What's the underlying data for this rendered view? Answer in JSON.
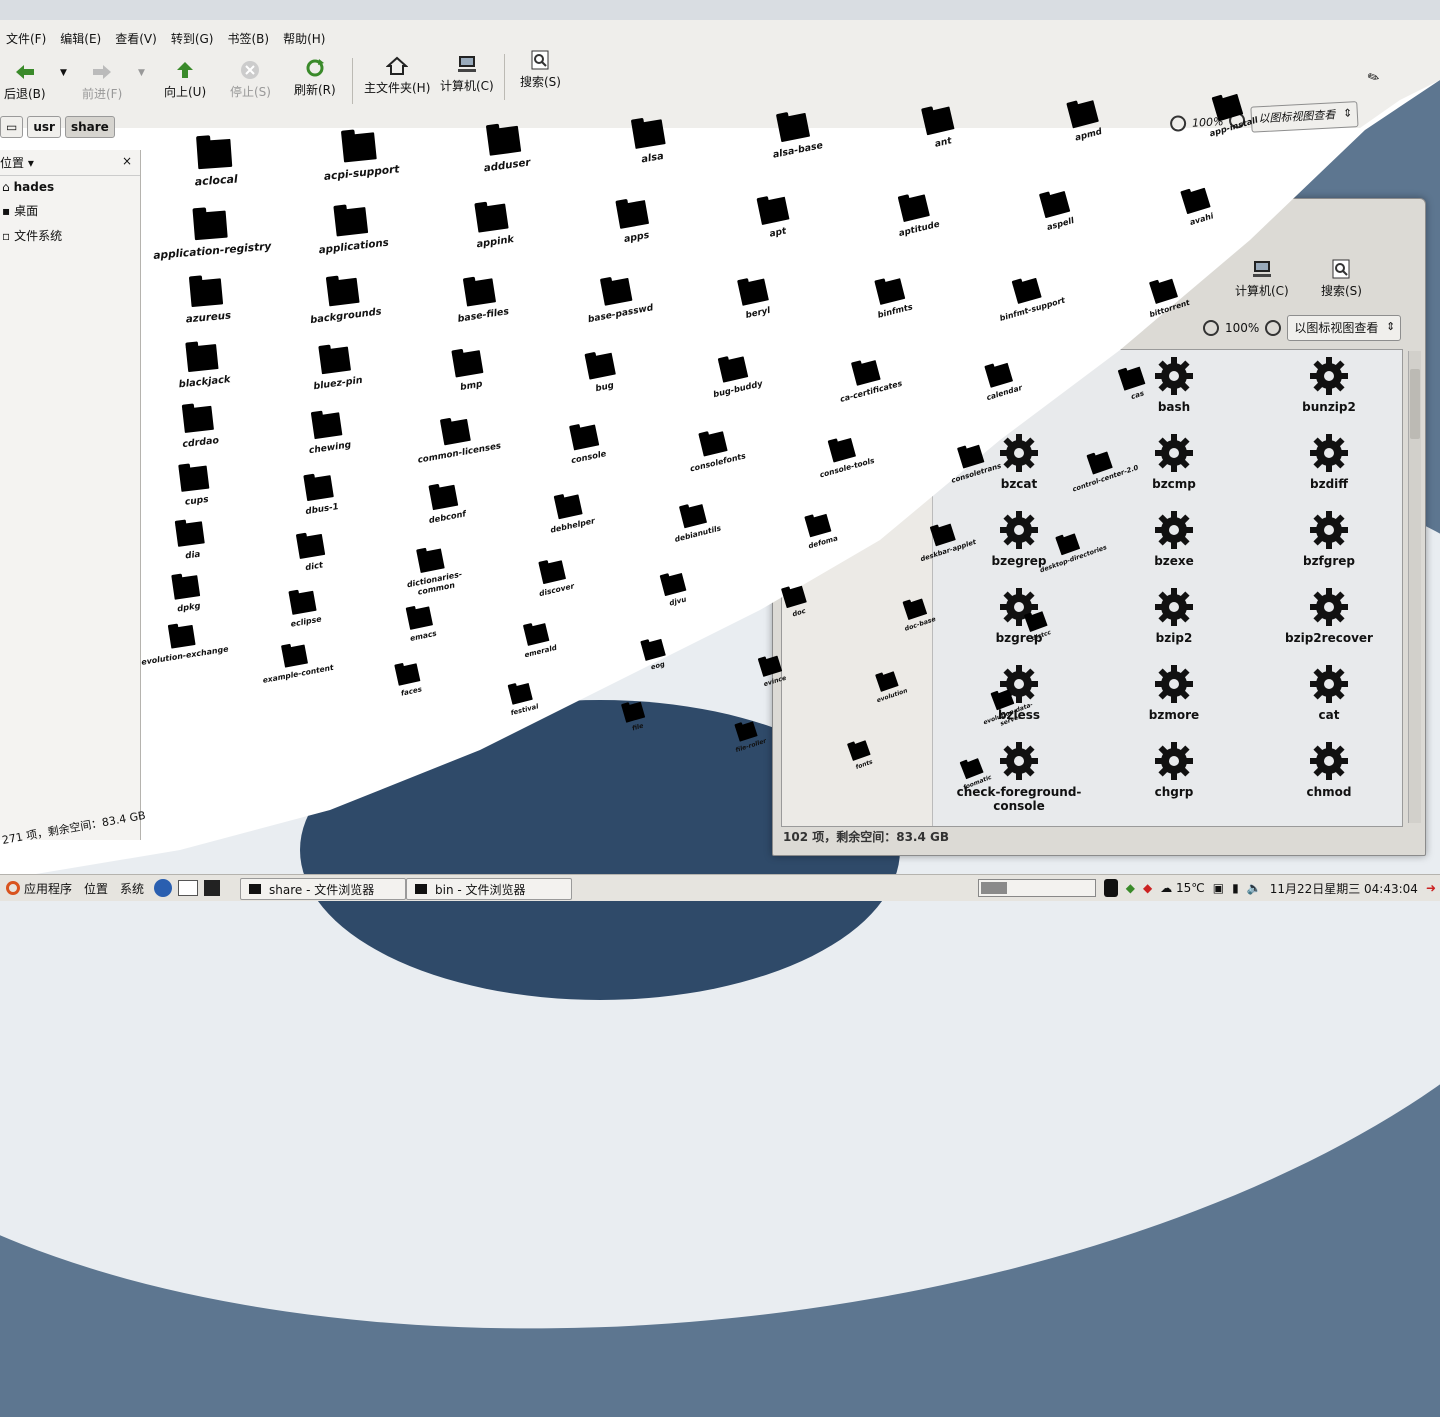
{
  "share_window": {
    "menu": [
      "文件(F)",
      "编辑(E)",
      "查看(V)",
      "转到(G)",
      "书签(B)",
      "帮助(H)"
    ],
    "toolbar": {
      "back": "后退(B)",
      "forward": "前进(F)",
      "up": "向上(U)",
      "stop": "停止(S)",
      "reload": "刷新(R)",
      "home": "主文件夹(H)",
      "computer": "计算机(C)",
      "search": "搜索(S)"
    },
    "zoom": "100%",
    "view_mode": "以图标视图查看",
    "path": [
      "usr",
      "share"
    ],
    "sidebar": {
      "title": "位置",
      "close": "×",
      "items": [
        "hades",
        "桌面",
        "文件系统"
      ]
    },
    "status": "271 项，剩余空间：83.4 GB",
    "folders": [
      "aclocal",
      "acpi-support",
      "adduser",
      "alsa",
      "alsa-base",
      "ant",
      "apmd",
      "app-install",
      "application-registry",
      "applications",
      "appink",
      "apps",
      "apt",
      "aptitude",
      "aspell",
      "avahi",
      "azureus",
      "backgrounds",
      "base-files",
      "base-passwd",
      "beryl",
      "binfmts",
      "binfmt-support",
      "bittorrent",
      "blackjack",
      "bluez-pin",
      "bmp",
      "bug",
      "bug-buddy",
      "ca-certificates",
      "calendar",
      "cas",
      "cdrdao",
      "chewing",
      "common-licenses",
      "console",
      "consolefonts",
      "console-tools",
      "consoletrans",
      "control-center-2.0",
      "cups",
      "dbus-1",
      "debconf",
      "debhelper",
      "debianutils",
      "defoma",
      "deskbar-applet",
      "desktop-directories",
      "dia",
      "dict",
      "dictionaries-common",
      "discover",
      "djvu",
      "doc",
      "doc-base",
      "distcc",
      "dpkg",
      "eclipse",
      "emacs",
      "emerald",
      "eog",
      "evince",
      "evolution",
      "evolution-data-server",
      "evolution-exchange",
      "example-content",
      "faces",
      "festival",
      "file",
      "file-roller",
      "fonts",
      "foomatic"
    ]
  },
  "bin_window": {
    "toolbar": {
      "computer": "计算机(C)",
      "search": "搜索(S)"
    },
    "zoom": "100%",
    "view_mode": "以图标视图查看",
    "items": [
      "bash",
      "bunzip2",
      "bzcat",
      "bzcmp",
      "bzdiff",
      "bzegrep",
      "bzexe",
      "bzfgrep",
      "bzgrep",
      "bzip2",
      "bzip2recover",
      "bzless",
      "bzmore",
      "cat",
      "check-foreground-console",
      "chgrp",
      "chmod"
    ],
    "status": "102 项，剩余空间：83.4 GB"
  },
  "panel": {
    "menus": [
      "应用程序",
      "位置",
      "系统"
    ],
    "tasks": [
      "share - 文件浏览器",
      "bin - 文件浏览器"
    ],
    "weather": "15℃",
    "clock": "11月22日星期三 04:43:04"
  },
  "colors": {
    "panel": "#e6e4df",
    "window": "#efeeeb",
    "desktop": "#5d7690"
  }
}
